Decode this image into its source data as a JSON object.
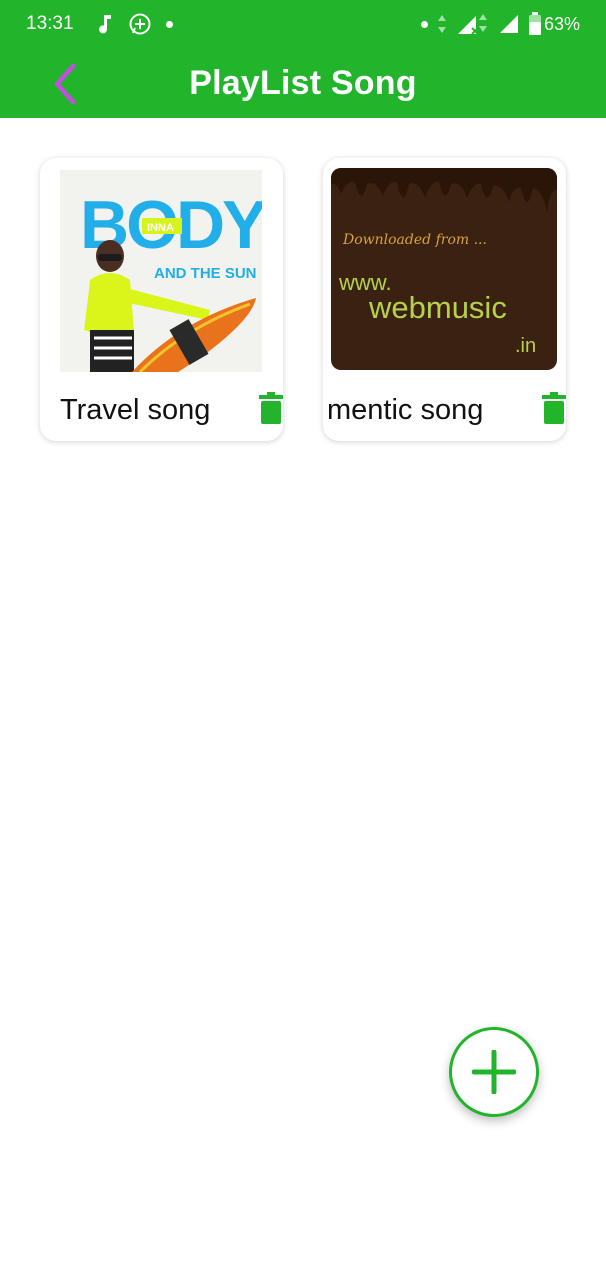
{
  "status_bar": {
    "time": "13:31",
    "battery": "63%",
    "icons": [
      "music-note-icon",
      "whatsapp-icon",
      "notification-dot-icon",
      "data-arrows-icon",
      "signal-no-service-icon",
      "signal-icon",
      "battery-icon"
    ]
  },
  "app_bar": {
    "title": "PlayList Song",
    "back_icon": "chevron-left-icon"
  },
  "playlists": [
    {
      "name": "Travel song",
      "art": {
        "title": "BODY",
        "badge": "INNA",
        "subtitle": "AND THE SUN"
      }
    },
    {
      "name": "mentic song",
      "art": {
        "line1": "Downloaded from ...",
        "line2": "www.",
        "line3": "webmusic",
        "line4": ".in"
      }
    }
  ],
  "fab": {
    "icon": "plus-icon"
  },
  "colors": {
    "primary": "#22b52b",
    "back_icon": "#c44ee0",
    "delete_icon": "#22b52b"
  }
}
